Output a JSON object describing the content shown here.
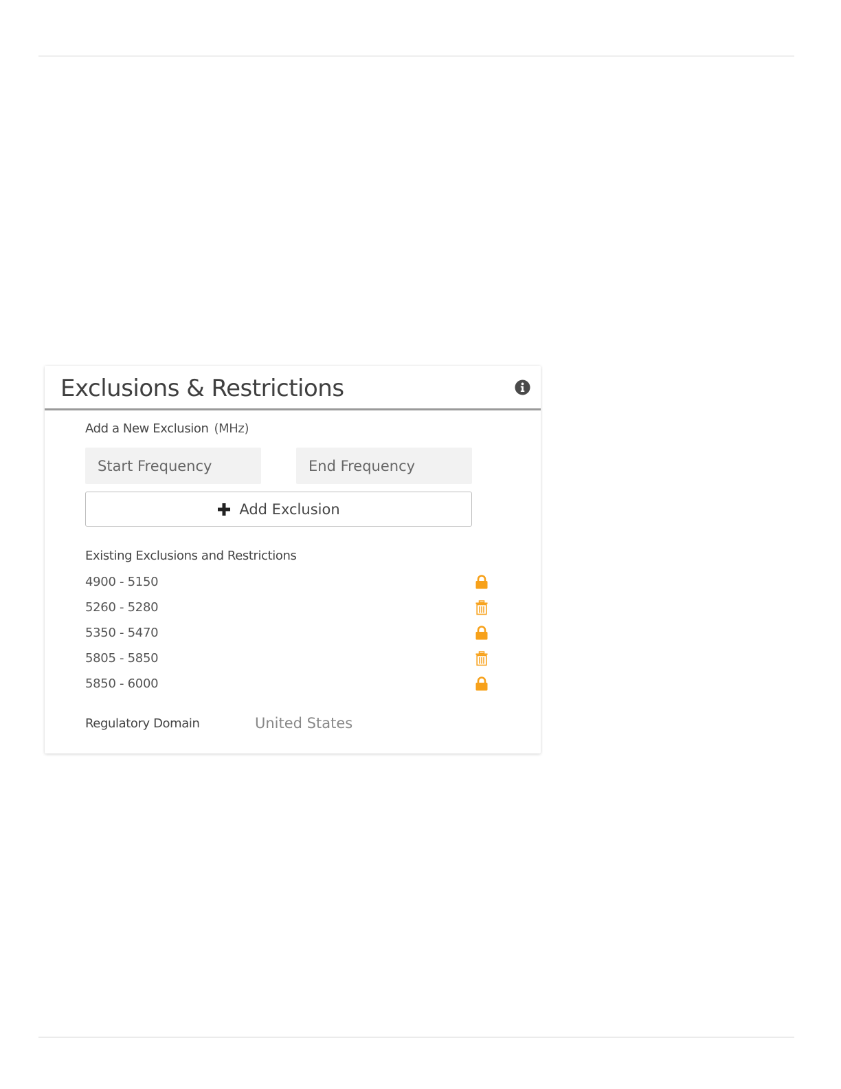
{
  "panel": {
    "title": "Exclusions & Restrictions",
    "info_icon": "info-icon"
  },
  "add_section": {
    "label": "Add a New Exclusion",
    "unit": "(MHz)",
    "start_placeholder": "Start Frequency",
    "end_placeholder": "End Frequency",
    "add_button_label": "Add Exclusion",
    "add_button_icon": "plus-icon"
  },
  "existing": {
    "label": "Existing Exclusions and Restrictions",
    "items": [
      {
        "range": "4900 - 5150",
        "icon": "lock-icon"
      },
      {
        "range": "5260 - 5280",
        "icon": "trash-icon"
      },
      {
        "range": "5350 - 5470",
        "icon": "lock-icon"
      },
      {
        "range": "5805 - 5850",
        "icon": "trash-icon"
      },
      {
        "range": "5850 - 6000",
        "icon": "lock-icon"
      }
    ]
  },
  "regulatory": {
    "label": "Regulatory Domain",
    "value": "United States"
  },
  "colors": {
    "accent": "#f7a11a",
    "header_rule": "#9a9a9a",
    "input_bg": "#f2f2f2"
  }
}
